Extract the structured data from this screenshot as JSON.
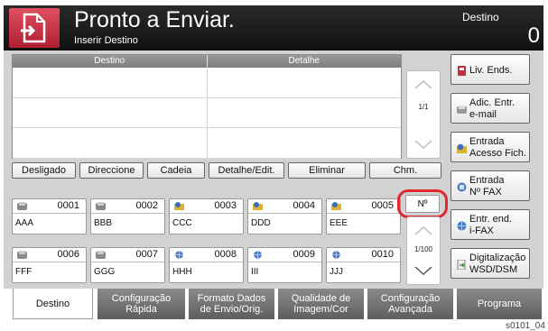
{
  "header": {
    "title": "Pronto a Enviar.",
    "subtitle": "Inserir Destino",
    "dest_label": "Destino",
    "dest_count": "0"
  },
  "dest_table": {
    "columns": [
      "Destino",
      "Detalhe"
    ],
    "page": "1/1"
  },
  "function_buttons": [
    "Desligado",
    "Direccione",
    "Cadeia",
    "Detalhe/Edit.",
    "Eliminar",
    "Chm."
  ],
  "one_touch": {
    "rows": [
      [
        {
          "num": "0001",
          "name": "AAA",
          "icon": "fax-icon"
        },
        {
          "num": "0002",
          "name": "BBB",
          "icon": "fax-icon"
        },
        {
          "num": "0003",
          "name": "CCC",
          "icon": "folder-icon"
        },
        {
          "num": "0004",
          "name": "DDD",
          "icon": "folder-icon"
        },
        {
          "num": "0005",
          "name": "EEE",
          "icon": "folder-icon"
        }
      ],
      [
        {
          "num": "0006",
          "name": "FFF",
          "icon": "fax-icon"
        },
        {
          "num": "0007",
          "name": "GGG",
          "icon": "fax-icon"
        },
        {
          "num": "0008",
          "name": "HHH",
          "icon": "globe-icon"
        },
        {
          "num": "0009",
          "name": "III",
          "icon": "globe-icon"
        },
        {
          "num": "0010",
          "name": "JJJ",
          "icon": "globe-icon"
        }
      ]
    ],
    "number_button": "Nº",
    "page": "1/100"
  },
  "right_buttons": [
    {
      "lines": [
        "Liv. Ends."
      ],
      "icon": "address-book-icon"
    },
    {
      "lines": [
        "Adic. Entr.",
        "e-mail"
      ],
      "icon": "email-icon"
    },
    {
      "lines": [
        "Entrada",
        "Acesso Fich."
      ],
      "icon": "folder-icon"
    },
    {
      "lines": [
        "Entrada",
        "Nº FAX"
      ],
      "icon": "fax-icon"
    },
    {
      "lines": [
        "Entr. end.",
        "i-FAX"
      ],
      "icon": "globe-icon"
    },
    {
      "lines": [
        "Digitalização",
        "WSD/DSM"
      ],
      "icon": "wsd-icon"
    }
  ],
  "tabs": [
    {
      "lines": [
        "Destino"
      ],
      "active": true
    },
    {
      "lines": [
        "Configuração",
        "Rápida"
      ],
      "active": false
    },
    {
      "lines": [
        "Formato Dados",
        "de Envio/Orig."
      ],
      "active": false
    },
    {
      "lines": [
        "Qualidade de",
        "Imagem/Cor"
      ],
      "active": false
    },
    {
      "lines": [
        "Configuração",
        "Avançada"
      ],
      "active": false
    },
    {
      "lines": [
        "Programa"
      ],
      "active": false
    }
  ],
  "image_code": "s0101_04"
}
